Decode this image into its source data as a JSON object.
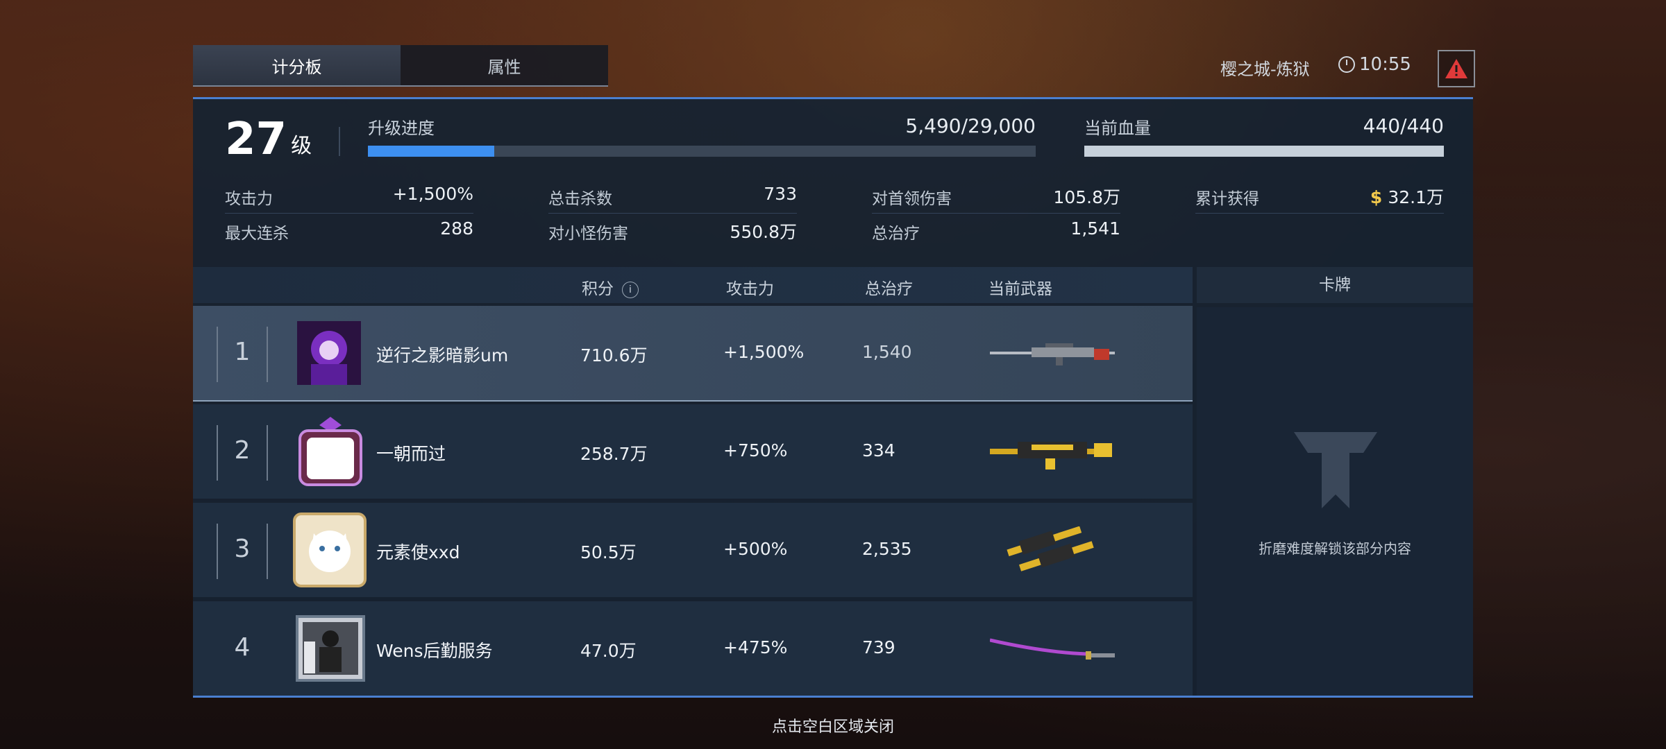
{
  "tabs": [
    {
      "label": "计分板",
      "active": true
    },
    {
      "label": "属性",
      "active": false
    }
  ],
  "header": {
    "map_name": "樱之城-炼狱",
    "timer": "10:55"
  },
  "player": {
    "level": "27",
    "level_unit": "级",
    "xp_label": "升级进度",
    "xp_value": "5,490/29,000",
    "xp_fraction": 0.189,
    "hp_label": "当前血量",
    "hp_value": "440/440",
    "hp_fraction": 1.0
  },
  "stats": {
    "attack_label": "攻击力",
    "attack_value": "+1,500%",
    "max_streak_label": "最大连杀",
    "max_streak_value": "288",
    "kills_label": "总击杀数",
    "kills_value": "733",
    "minion_dmg_label": "对小怪伤害",
    "minion_dmg_value": "550.8万",
    "boss_dmg_label": "对首领伤害",
    "boss_dmg_value": "105.8万",
    "heal_label": "总治疗",
    "heal_value": "1,541",
    "earned_label": "累计获得",
    "earned_value": "32.1万",
    "currency_symbol": "$"
  },
  "table": {
    "headers": {
      "score": "积分",
      "attack": "攻击力",
      "heal": "总治疗",
      "weapon": "当前武器",
      "cards": "卡牌"
    },
    "info_glyph": "i",
    "rows": [
      {
        "rank": "1",
        "name": "逆行之影暗影um",
        "score": "710.6万",
        "attack": "+1,500%",
        "heal": "1,540"
      },
      {
        "rank": "2",
        "name": "一朝而过",
        "score": "258.7万",
        "attack": "+750%",
        "heal": "334"
      },
      {
        "rank": "3",
        "name": "元素使xxd",
        "score": "50.5万",
        "attack": "+500%",
        "heal": "2,535"
      },
      {
        "rank": "4",
        "name": "Wens后勤服务",
        "score": "47.0万",
        "attack": "+475%",
        "heal": "739"
      }
    ]
  },
  "cards_locked_text": "折磨难度解锁该部分内容",
  "close_hint": "点击空白区域关闭",
  "colors": {
    "accent": "#3d8ff0",
    "gold": "#f2c94c",
    "warning": "#e03a3a"
  }
}
